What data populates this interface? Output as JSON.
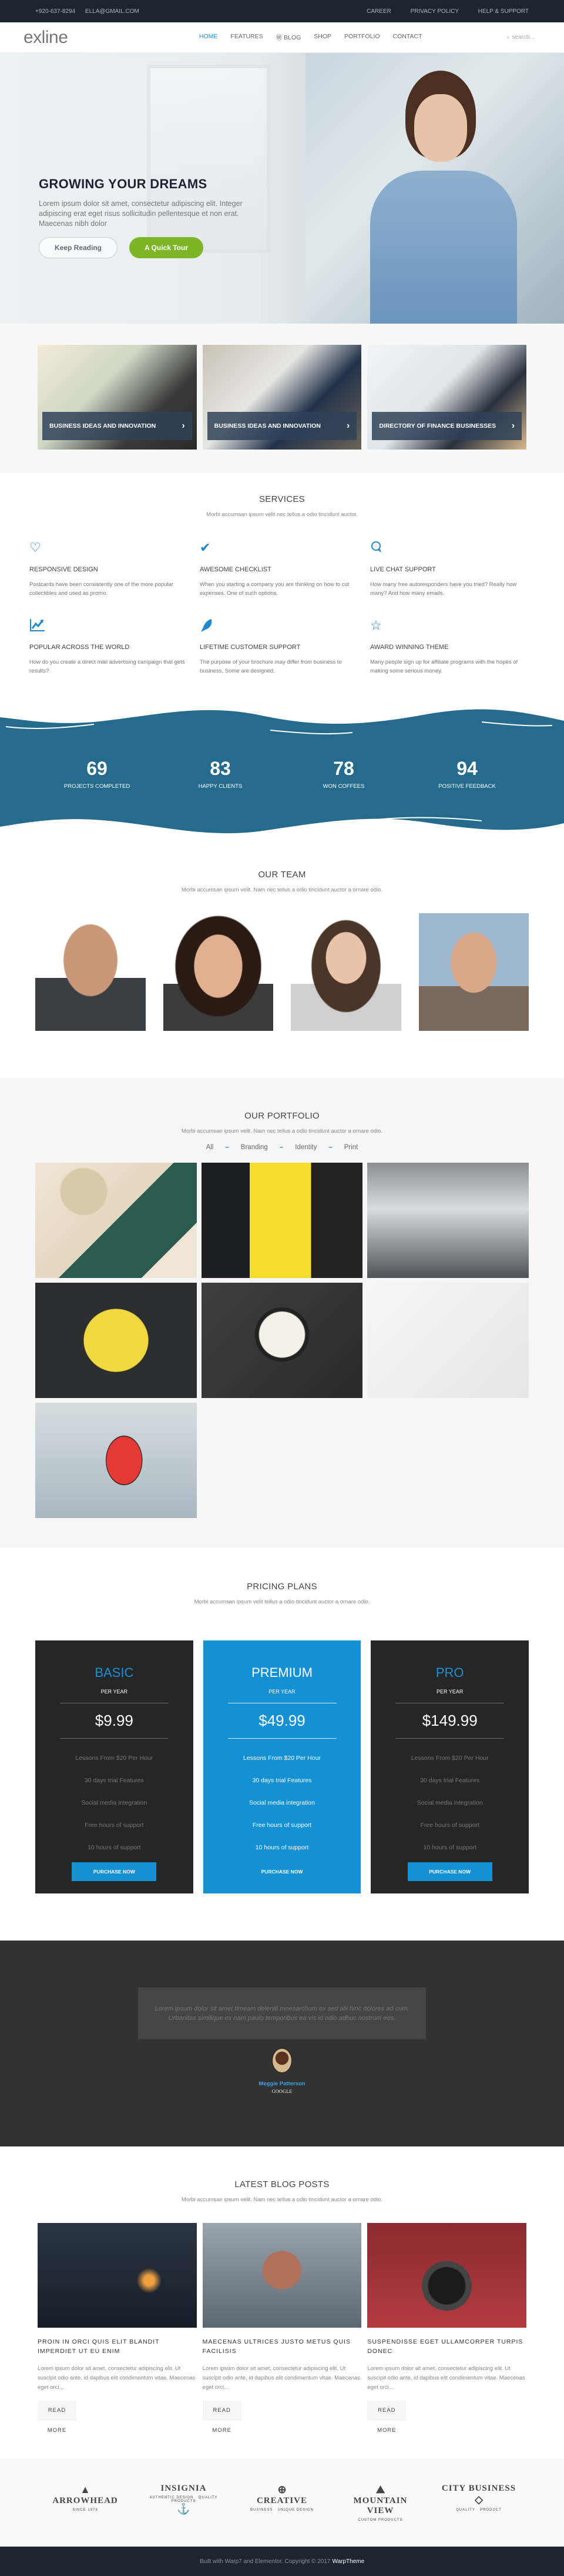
{
  "topbar": {
    "phone": "+920-637-8294",
    "email": "ELLA@GMAIL.COM",
    "links": [
      "CAREER",
      "PRIVACY POLICY",
      "HELP & SUPPORT"
    ]
  },
  "header": {
    "logo": "exline",
    "nav": [
      "HOME",
      "FEATURES",
      "BLOG",
      "SHOP",
      "PORTFOLIO",
      "CONTACT"
    ],
    "active_nav": "HOME",
    "search_placeholder": "search..."
  },
  "hero": {
    "title": "GROWING YOUR DREAMS",
    "text": "Lorem ipsum dolor sit amet, consectetur adipiscing elit. Integer adipiscing erat eget risus sollicitudin pellentesque et non erat. Maecenas nibh dolor",
    "primary_button": "Keep Reading",
    "secondary_button": "A Quick Tour",
    "slides": 3,
    "active_slide": 1
  },
  "features": [
    {
      "title": "BUSINESS IDEAS AND INNOVATION"
    },
    {
      "title": "BUSINESS IDEAS AND INNOVATION"
    },
    {
      "title": "DIRECTORY OF FINANCE BUSINESSES"
    }
  ],
  "services": {
    "title": "SERVICES",
    "subtitle": "Morbi accumsan ipsum velit nec tellus a odio tincidunt auctor.",
    "items": [
      {
        "icon": "heart-icon",
        "glyph": "♡",
        "title": "RESPONSIVE DESIGN",
        "text": "Postcards have been consistently one of the more popular collectibles and used as promo."
      },
      {
        "icon": "checkmark-icon",
        "glyph": "✔",
        "title": "AWESOME CHECKLIST",
        "text": "When you starting a company you are thinking on how to cut expenses. One of such options."
      },
      {
        "icon": "chat-icon",
        "glyph": "💬",
        "title": "LIVE CHAT SUPPORT",
        "text": "How many free autoresponders have you tried? Really how many? And how many emails."
      },
      {
        "icon": "chart-line-icon",
        "glyph": "📈",
        "title": "POPULAR ACROSS THE WORLD",
        "text": "How do you create a direct mail advertising campaign that gets results?"
      },
      {
        "icon": "rocket-icon",
        "glyph": "🚀",
        "title": "LIFETIME CUSTOMER SUPPORT",
        "text": "The purpose of your brochure may differ from business to business, Some are designed."
      },
      {
        "icon": "star-icon",
        "glyph": "☆",
        "title": "AWARD WINNING THEME",
        "text": "Many people sign up for affiliate programs with the hopes of making some serious money."
      }
    ]
  },
  "counters": [
    {
      "value": "69",
      "label": "PROJECTS COMPLETED"
    },
    {
      "value": "83",
      "label": "HAPPY CLIENTS"
    },
    {
      "value": "78",
      "label": "WON COFFEES"
    },
    {
      "value": "94",
      "label": "POSITIVE FEEDBACK"
    }
  ],
  "team": {
    "title": "OUR TEAM",
    "subtitle": "Morbi accumsan ipsum velit. Nam nec tellus a odio tincidunt auctor a ornare odio.",
    "members": 4
  },
  "portfolio": {
    "title": "OUR PORTFOLIO",
    "subtitle": "Morbi accumsan ipsum velit. Nam nec tellus a odio tincidunt auctor a ornare odio.",
    "filters": [
      "All",
      "Branding",
      "Identity",
      "Print"
    ],
    "separator": "–",
    "items": 6
  },
  "pricing": {
    "title": "PRICING PLANS",
    "subtitle": "Morbi accumsan ipsum velit tellus a odio tincidunt auctor a ornare odio.",
    "plans": [
      {
        "name": "BASIC",
        "period": "PER YEAR",
        "price": "$9.99",
        "features": [
          "Lessons From $20 Per Hour",
          "30 days trial Features",
          "Social media integration",
          "Free hours of support",
          "10 hours of support"
        ],
        "button": "PURCHASE NOW"
      },
      {
        "name": "PREMIUM",
        "period": "PER YEAR",
        "price": "$49.99",
        "features": [
          "Lessons From $20 Per Hour",
          "30 days trial Features",
          "Social media integration",
          "Free hours of support",
          "10 hours of support"
        ],
        "button": "PURCHASE NOW"
      },
      {
        "name": "PRO",
        "period": "PER YEAR",
        "price": "$149.99",
        "features": [
          "Lessons From $20 Per Hour",
          "30 days trial Features",
          "Social media integration",
          "Free hours of support",
          "10 hours of support"
        ],
        "button": "PURCHASE NOW"
      }
    ]
  },
  "testimonial": {
    "quote": "Lorem ipsum dolor sit amet timeam deleniti mnesarchum ex sed alii hinc dolores ad cum. Urbanitas similique ex nam paulo temporibus ea vis id odio adhuc nostrum eos.",
    "author": "Meggie Patterson",
    "company": "GOOGLE"
  },
  "blog": {
    "title": "LATEST BLOG POSTS",
    "subtitle": "Morbi accumsan ipsum velit. Nam nec tellus a odio tincidunt auctor a ornare odio.",
    "posts": [
      {
        "title": "PROIN IN ORCI QUIS ELIT BLANDIT IMPERDIET UT EU ENIM",
        "excerpt": "Lorem ipsum dolor sit amet, consectetur adipiscing elit. Ut suscipit odio ante, id dapibus elit condimentum vitae. Maecenas eget orci...",
        "button": "READ MORE"
      },
      {
        "title": "MAECENAS ULTRICES JUSTO METUS QUIS FACILISIS",
        "excerpt": "Lorem ipsum dolor sit amet, consectetur adipiscing elit. Ut suscipit odio ante, id dapibus elit condimentum vitae. Maecenas eget orci...",
        "button": "READ MORE"
      },
      {
        "title": "SUSPENDISSE EGET ULLAMCORPER TURPIS DONEC",
        "excerpt": "Lorem ipsum dolor sit amet, consectetur adipiscing elit. Ut suscipit odio ante, id dapibus elit condimentum vitae. Maecenas eget orci...",
        "button": "READ MORE"
      }
    ]
  },
  "brands": [
    {
      "name": "ARROWHEAD",
      "tag": "SINCE 1978",
      "glyph": "▲"
    },
    {
      "name": "INSIGNIA",
      "tag": "AUTHENTIC DESIGN · QUALITY PRODUCTS",
      "glyph": "⚓"
    },
    {
      "name": "CREATIVE",
      "tag": "BUSINESS · UNIQUE DESIGN",
      "glyph": "⊕"
    },
    {
      "name": "MOUNTAIN VIEW",
      "tag": "CUSTOM PRODUCTS",
      "glyph": "⛰"
    },
    {
      "name": "CITY BUSINESS",
      "tag": "QUALITY · PRODUCT",
      "glyph": "◇"
    }
  ],
  "footer": {
    "text": "Built with Warp7 and Elementor. Copyright © 2017",
    "brand": "WarpTheme"
  }
}
